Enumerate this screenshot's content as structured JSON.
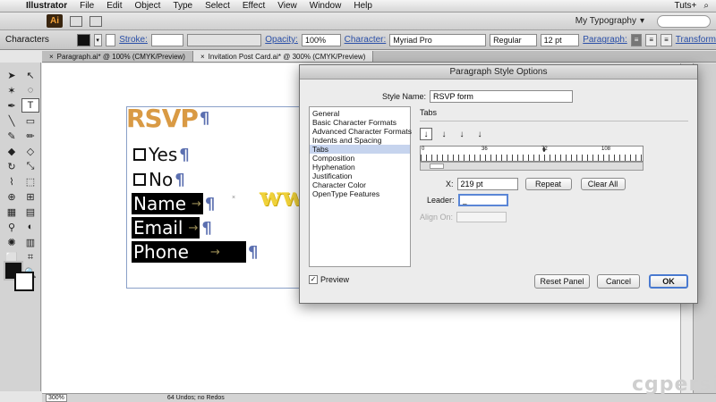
{
  "menubar": {
    "app": "Illustrator",
    "items": [
      "File",
      "Edit",
      "Object",
      "Type",
      "Select",
      "Effect",
      "View",
      "Window",
      "Help"
    ],
    "user": "Tuts+"
  },
  "appbar": {
    "logo": "Ai",
    "workspace": "My Typography"
  },
  "controlbar": {
    "characters": "Characters",
    "stroke": "Stroke:",
    "opacity_label": "Opacity:",
    "opacity_value": "100%",
    "character_label": "Character:",
    "font": "Myriad Pro",
    "style": "Regular",
    "size": "12 pt",
    "paragraph": "Paragraph:",
    "transform": "Transform"
  },
  "tabs": [
    {
      "label": "Paragraph.ai* @ 100% (CMYK/Preview)"
    },
    {
      "label": "Invitation Post Card.ai* @ 300% (CMYK/Preview)"
    }
  ],
  "artwork": {
    "rsvp": "RSVP",
    "pilcrow": "¶",
    "yes": "Yes",
    "no": "No",
    "name": "Name",
    "email": "Email",
    "phone": "Phone",
    "arrow": "→",
    "small_x": "×"
  },
  "watermark": "www.cgtsj.com",
  "watermark2": "cgpersia",
  "statusbar": {
    "zoom": "300%",
    "undos": "64 Undos; no Redos"
  },
  "dialog": {
    "title": "Paragraph Style Options",
    "style_name_label": "Style Name:",
    "style_name_value": "RSVP form",
    "categories": [
      "General",
      "Basic Character Formats",
      "Advanced Character Formats",
      "Indents and Spacing",
      "Tabs",
      "Composition",
      "Hyphenation",
      "Justification",
      "Character Color",
      "OpenType Features"
    ],
    "selected_category": "Tabs",
    "section_title": "Tabs",
    "ruler_labels": [
      "0",
      "36",
      "72",
      "108"
    ],
    "x_label": "X:",
    "x_value": "219 pt",
    "repeat": "Repeat",
    "clear_all": "Clear All",
    "leader_label": "Leader:",
    "leader_value": "_",
    "align_on_label": "Align On:",
    "preview": "Preview",
    "reset_panel": "Reset Panel",
    "cancel": "Cancel",
    "ok": "OK"
  }
}
